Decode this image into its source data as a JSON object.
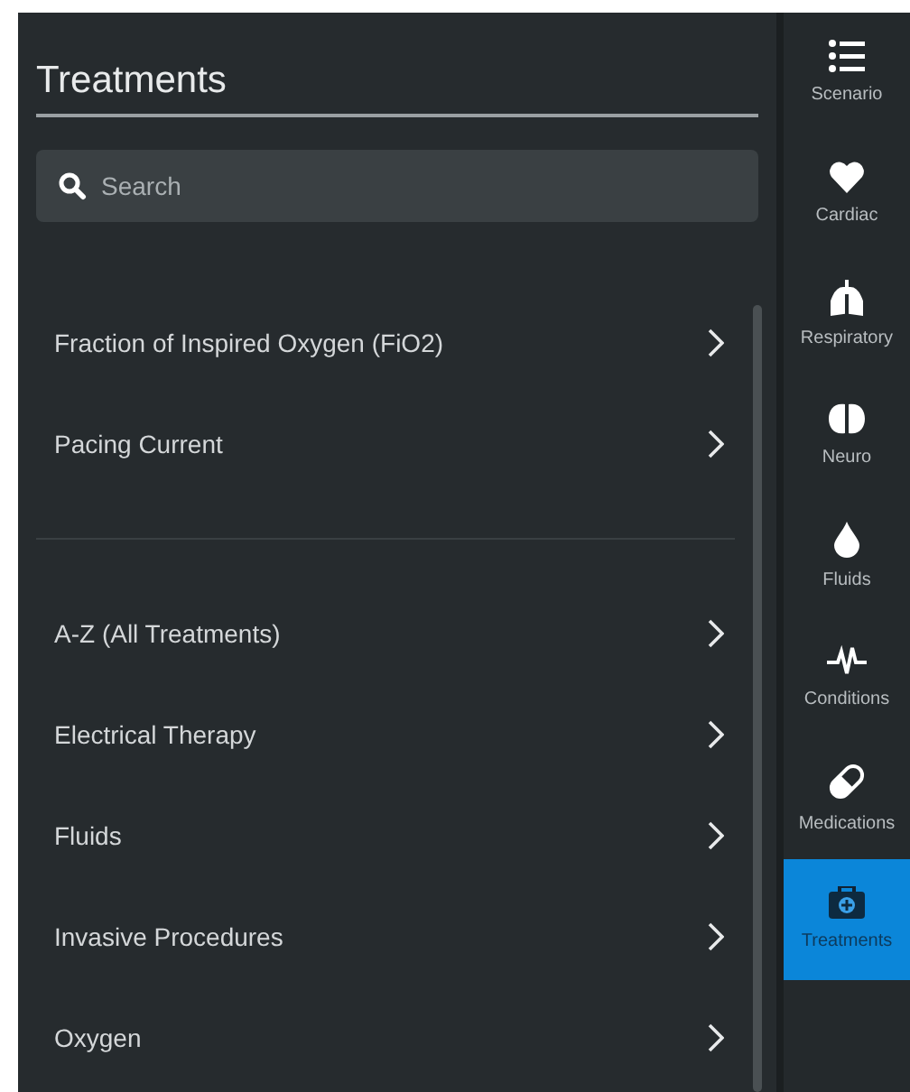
{
  "panel": {
    "title": "Treatments",
    "search": {
      "placeholder": "Search"
    },
    "groups": [
      [
        {
          "label": "Fraction of Inspired Oxygen (FiO2)"
        },
        {
          "label": "Pacing Current"
        }
      ],
      [
        {
          "label": "A-Z (All Treatments)"
        },
        {
          "label": "Electrical Therapy"
        },
        {
          "label": "Fluids"
        },
        {
          "label": "Invasive Procedures"
        },
        {
          "label": "Oxygen"
        }
      ]
    ]
  },
  "sidebar": {
    "items": [
      {
        "kind": "list",
        "label": "Scenario",
        "selected": false
      },
      {
        "kind": "heart",
        "label": "Cardiac",
        "selected": false
      },
      {
        "kind": "lungs",
        "label": "Respiratory",
        "selected": false
      },
      {
        "kind": "brain",
        "label": "Neuro",
        "selected": false
      },
      {
        "kind": "drop",
        "label": "Fluids",
        "selected": false
      },
      {
        "kind": "pulse",
        "label": "Conditions",
        "selected": false
      },
      {
        "kind": "pill",
        "label": "Medications",
        "selected": false
      },
      {
        "kind": "kit",
        "label": "Treatments",
        "selected": true
      }
    ]
  }
}
